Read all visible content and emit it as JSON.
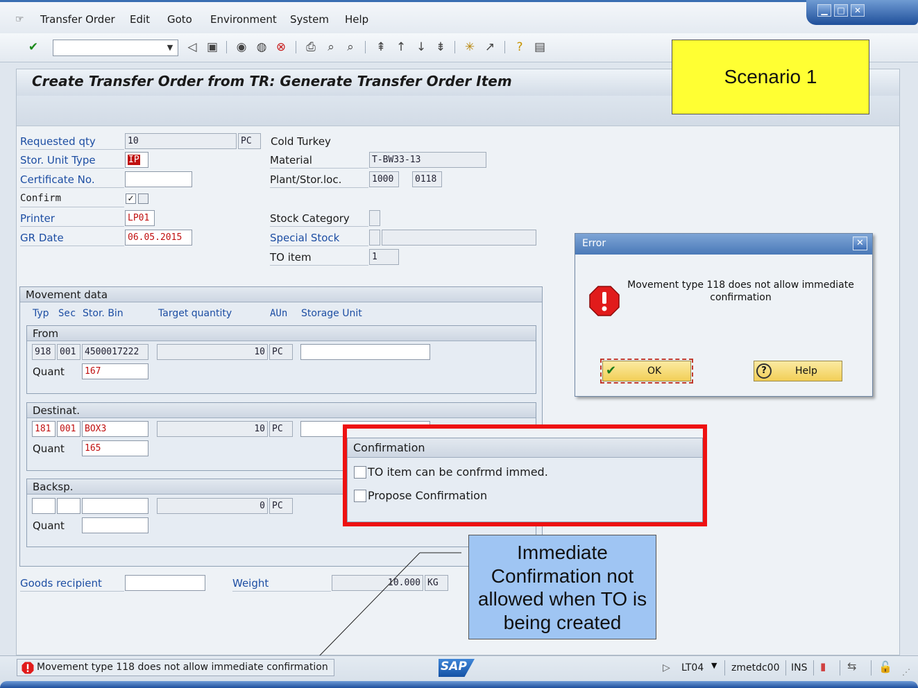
{
  "menu": {
    "items": [
      "Transfer Order",
      "Edit",
      "Goto",
      "Environment",
      "System",
      "Help"
    ]
  },
  "toolbar": {
    "command_field_value": ""
  },
  "page_title": "Create Transfer Order from TR: Generate Transfer Order Item",
  "header_fields": {
    "requested_qty": {
      "label": "Requested qty",
      "value": "10",
      "unit": "PC"
    },
    "stor_unit_type": {
      "label": "Stor. Unit Type",
      "value": "IP"
    },
    "certificate_no": {
      "label": "Certificate No.",
      "value": ""
    },
    "confirm": {
      "label": "Confirm",
      "checked": true
    },
    "printer": {
      "label": "Printer",
      "value": "LP01"
    },
    "gr_date": {
      "label": "GR Date",
      "value": "06.05.2015"
    },
    "material_desc": "Cold Turkey",
    "material": {
      "label": "Material",
      "value": "T-BW33-13"
    },
    "plant_stor_loc": {
      "label": "Plant/Stor.loc.",
      "plant": "1000",
      "stor_loc": "0118"
    },
    "stock_category": {
      "label": "Stock Category",
      "value": ""
    },
    "special_stock": {
      "label": "Special Stock",
      "value": "",
      "value2": ""
    },
    "to_item": {
      "label": "TO item",
      "value": "1"
    }
  },
  "movement_data": {
    "title": "Movement data",
    "columns": {
      "typ": "Typ",
      "sec": "Sec",
      "stor_bin": "Stor. Bin",
      "target_quantity": "Target quantity",
      "aun": "AUn",
      "storage_unit": "Storage Unit"
    },
    "quant_label": "Quant",
    "from": {
      "title": "From",
      "typ": "918",
      "sec": "001",
      "bin": "4500017222",
      "qty": "10",
      "unit": "PC",
      "storage_unit": "",
      "quant": "167"
    },
    "destinat": {
      "title": "Destinat.",
      "typ": "181",
      "sec": "001",
      "bin": "BOX3",
      "qty": "10",
      "unit": "PC",
      "storage_unit": "",
      "quant": "165"
    },
    "backsp": {
      "title": "Backsp.",
      "typ": "",
      "sec": "",
      "bin": "",
      "qty": "0",
      "unit": "PC",
      "quant": ""
    }
  },
  "footer_fields": {
    "goods_recipient": {
      "label": "Goods recipient",
      "value": ""
    },
    "weight": {
      "label": "Weight",
      "value": "10.000",
      "unit": "KG"
    }
  },
  "confirmation_group": {
    "title": "Confirmation",
    "option1": "TO item can be confrmd immed.",
    "option2": "Propose Confirmation"
  },
  "error_dialog": {
    "title": "Error",
    "message": "Movement type 118 does not allow immediate confirmation",
    "ok_label": "OK",
    "help_label": "Help"
  },
  "annotations": {
    "scenario": "Scenario 1",
    "callout": "Immediate Confirmation not allowed when TO is being created"
  },
  "statusbar": {
    "message": "Movement type 118 does not allow immediate confirmation",
    "transaction": "LT04",
    "server": "zmetdc00",
    "mode": "INS",
    "logo": "SAP"
  },
  "colors": {
    "label_blue": "#1d4ea3",
    "error_red": "#e11b1b",
    "highlight_red": "#ee1111",
    "scenario_yellow": "#ffff33",
    "callout_blue": "#9fc5f3"
  }
}
